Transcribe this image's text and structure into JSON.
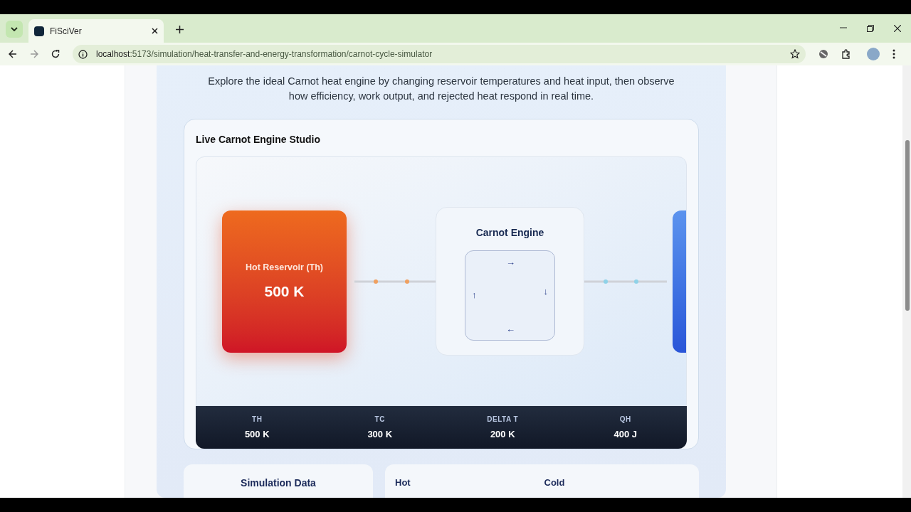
{
  "browser": {
    "tab_title": "FiSciVer",
    "url_host": "localhost",
    "url_path": ":5173/simulation/heat-transfer-and-energy-transformation/carnot-cycle-simulator"
  },
  "intro": "Explore the ideal Carnot heat engine by changing reservoir temperatures and heat input, then observe how efficiency, work output, and rejected heat respond in real time.",
  "studio": {
    "title": "Live Carnot Engine Studio",
    "hot_reservoir": {
      "label": "Hot Reservoir (Th)",
      "value": "500 K"
    },
    "engine": {
      "title": "Carnot Engine",
      "cycle_arrows": [
        "→",
        "↓",
        "←",
        "↑"
      ]
    },
    "stats": [
      {
        "label": "TH",
        "value": "500 K"
      },
      {
        "label": "TC",
        "value": "300 K"
      },
      {
        "label": "DELTA T",
        "value": "200 K"
      },
      {
        "label": "QH",
        "value": "400 J"
      }
    ]
  },
  "panels": [
    {
      "kind": "title",
      "texts": [
        "Simulation Data"
      ]
    },
    {
      "kind": "columns",
      "texts": [
        "Hot",
        "Cold"
      ]
    }
  ]
}
